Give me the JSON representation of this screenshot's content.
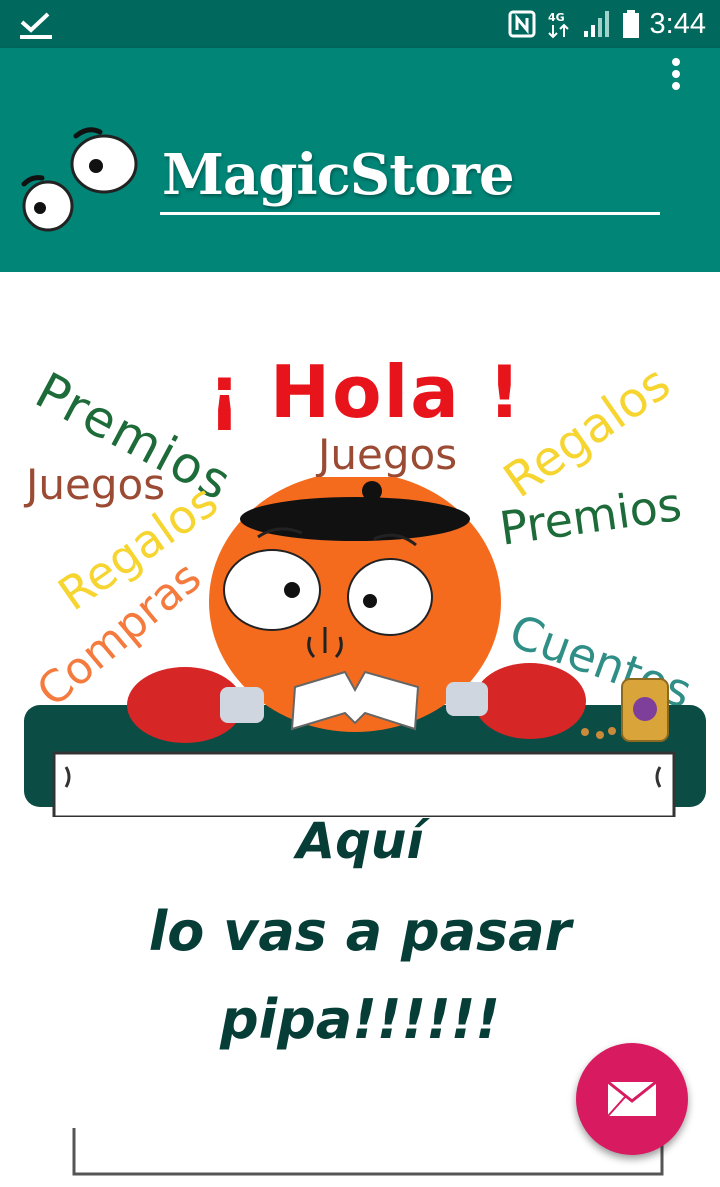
{
  "status_bar": {
    "time": "3:44",
    "network": "4G",
    "icons": [
      "download-done-icon",
      "nfc-icon",
      "network-4g-icon",
      "signal-icon",
      "battery-icon"
    ]
  },
  "app_bar": {
    "title": "MagicStore",
    "icons": [
      "eyes-logo-icon",
      "overflow-menu-icon"
    ]
  },
  "banner": {
    "greeting": "¡ Hola !",
    "words": {
      "premios_left": "Premios",
      "juegos_center": "Juegos",
      "regalos_right": "Regalos",
      "juegos_left": "Juegos",
      "regalos_left": "Regalos",
      "premios_right": "Premios",
      "compras": "Compras",
      "cuentos": "Cuentos"
    },
    "tagline": {
      "line1": "Aquí",
      "line2": "lo vas a pasar",
      "line3": "pipa!!!!!!"
    }
  },
  "fab": {
    "icon": "mail-icon"
  },
  "colors": {
    "status_bar": "#00685c",
    "app_bar": "#008577",
    "fab": "#d81b60",
    "greeting_red": "#e8141c",
    "word_green": "#1e6b3a",
    "word_brown": "#9b4a33",
    "word_yellow": "#f6d531",
    "word_orange": "#f47a3e",
    "word_teal": "#2f8f86",
    "tagline": "#063d36"
  }
}
